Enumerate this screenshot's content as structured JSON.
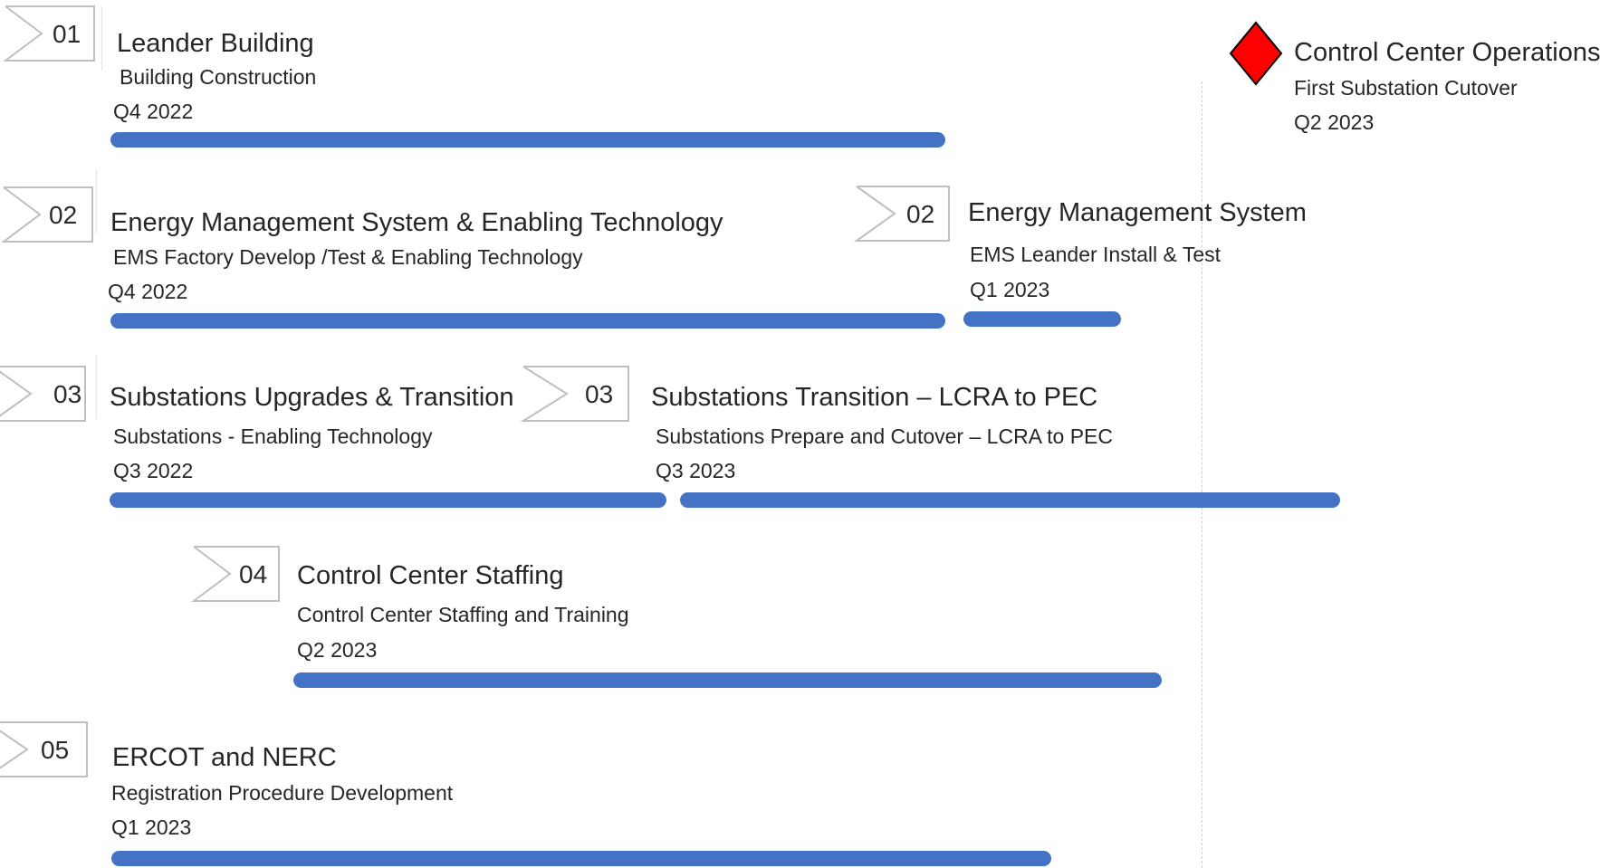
{
  "accent_color": "#4472c4",
  "milestone_color": "#ff0000",
  "icons": {
    "badge": "chevron-badge-icon",
    "milestone": "red-diamond-icon"
  },
  "rows": [
    {
      "number": "01",
      "title": "Leander Building",
      "subtitle": "Building Construction",
      "date": "Q4 2022"
    },
    {
      "number": "02",
      "title": "Energy Management System & Enabling Technology",
      "subtitle": "EMS Factory Develop /Test & Enabling Technology",
      "date": "Q4 2022"
    },
    {
      "number": "02",
      "title": "Energy Management System",
      "subtitle": "EMS Leander Install & Test",
      "date": "Q1 2023"
    },
    {
      "number": "03",
      "title": "Substations Upgrades & Transition",
      "subtitle": "Substations - Enabling Technology",
      "date": "Q3 2022"
    },
    {
      "number": "03",
      "title": "Substations Transition – LCRA to PEC",
      "subtitle": "Substations Prepare and Cutover – LCRA to PEC",
      "date": "Q3 2023"
    },
    {
      "number": "04",
      "title": "Control Center Staffing",
      "subtitle": "Control Center Staffing and Training",
      "date": "Q2 2023"
    },
    {
      "number": "05",
      "title": "ERCOT and NERC",
      "subtitle": "Registration Procedure Development",
      "date": "Q1 2023"
    }
  ],
  "milestone": {
    "title": "Control Center Operations",
    "subtitle": "First Substation Cutover",
    "date": "Q2 2023"
  }
}
